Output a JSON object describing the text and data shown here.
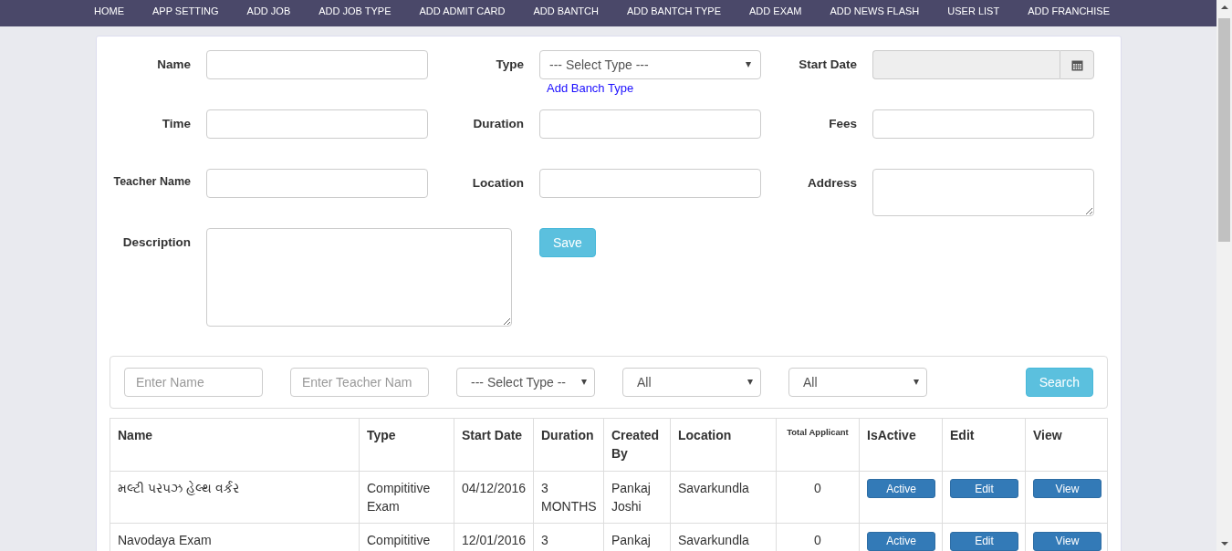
{
  "nav": [
    {
      "label": "HOME"
    },
    {
      "label": "APP SETTING"
    },
    {
      "label": "ADD JOB"
    },
    {
      "label": "ADD JOB TYPE"
    },
    {
      "label": "ADD ADMIT CARD"
    },
    {
      "label": "ADD BANTCH"
    },
    {
      "label": "ADD BANTCH TYPE"
    },
    {
      "label": "ADD EXAM"
    },
    {
      "label": "ADD NEWS FLASH"
    },
    {
      "label": "USER LIST"
    },
    {
      "label": "ADD FRANCHISE"
    }
  ],
  "form": {
    "fields": [
      {
        "label": "Name",
        "kind": "text"
      },
      {
        "label": "Type",
        "kind": "select",
        "value": "--- Select Type ---",
        "link": "Add Banch Type"
      },
      {
        "label": "Start Date",
        "kind": "date"
      },
      {
        "label": "Time",
        "kind": "text"
      },
      {
        "label": "Duration",
        "kind": "text"
      },
      {
        "label": "Fees",
        "kind": "text"
      },
      {
        "label": "Teacher Name",
        "kind": "text",
        "small": true
      },
      {
        "label": "Location",
        "kind": "text"
      },
      {
        "label": "Address",
        "kind": "textarea"
      },
      {
        "label": "Description",
        "kind": "textarea",
        "wide": true
      }
    ],
    "save_button": "Save"
  },
  "filters": {
    "items": [
      {
        "kind": "text",
        "placeholder": "Enter Name"
      },
      {
        "kind": "text",
        "placeholder": "Enter Teacher Nam"
      },
      {
        "kind": "select",
        "value": "--- Select Type --"
      },
      {
        "kind": "select",
        "value": "All"
      },
      {
        "kind": "select",
        "value": "All"
      }
    ],
    "search_button": "Search"
  },
  "table": {
    "columns": [
      {
        "label": "Name"
      },
      {
        "label": "Type"
      },
      {
        "label": "Start Date"
      },
      {
        "label": "Duration"
      },
      {
        "label": "Created By"
      },
      {
        "label": "Location"
      },
      {
        "label": "Total Applicant",
        "small": true
      },
      {
        "label": "IsActive"
      },
      {
        "label": "Edit"
      },
      {
        "label": "View"
      }
    ],
    "rows": [
      {
        "name": "મલ્ટી પરપઝ હેલ્થ વર્કર",
        "type": "Compititive Exam",
        "start_date": "04/12/2016",
        "duration": "3 MONTHS",
        "created_by": "Pankaj Joshi",
        "location": "Savarkundla",
        "total_applicant": "0",
        "is_active": "Active",
        "edit": "Edit",
        "view": "View"
      },
      {
        "name": "Navodaya Exam",
        "type": "Compititive",
        "start_date": "12/01/2016",
        "duration": "3",
        "created_by": "Pankaj",
        "location": "Savarkundla",
        "total_applicant": "0",
        "is_active": "Active",
        "edit": "Edit",
        "view": "View"
      }
    ]
  }
}
